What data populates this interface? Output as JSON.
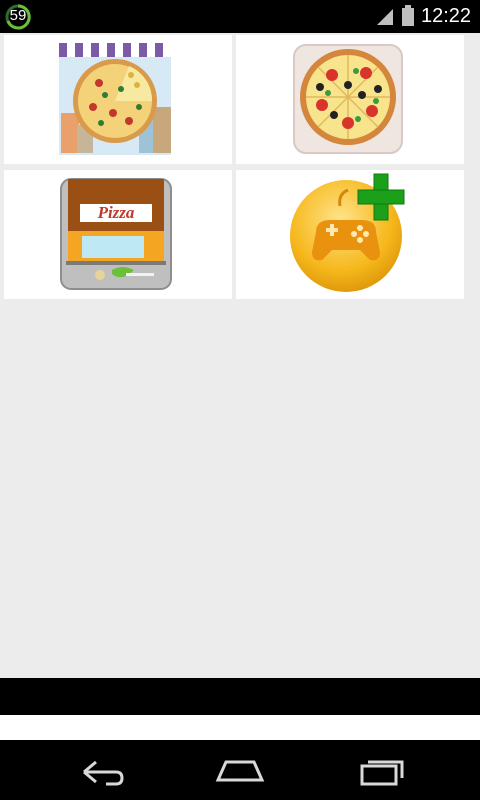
{
  "status_bar": {
    "counter": "59",
    "time": "12:22",
    "icons": [
      "progress-ring-icon",
      "signal-icon",
      "battery-icon"
    ]
  },
  "tiles": [
    {
      "name": "pizza-shop-tile",
      "icon": "pizza-shop-icon"
    },
    {
      "name": "pizza-tile",
      "icon": "pizza-icon"
    },
    {
      "name": "pizza-store-tile",
      "icon": "pizza-store-icon"
    },
    {
      "name": "more-games-tile",
      "icon": "gamepad-add-icon"
    }
  ],
  "tile_labels": {
    "store_sign": "Pizza"
  },
  "nav_bar": {
    "icons": [
      "back-icon",
      "home-icon",
      "recent-apps-icon"
    ]
  },
  "colors": {
    "background": "#ececec",
    "status_bar": "#000000",
    "tile": "#ffffff",
    "accent_green": "#2e9e2e",
    "gamepad_gold": "#f6b81c"
  }
}
